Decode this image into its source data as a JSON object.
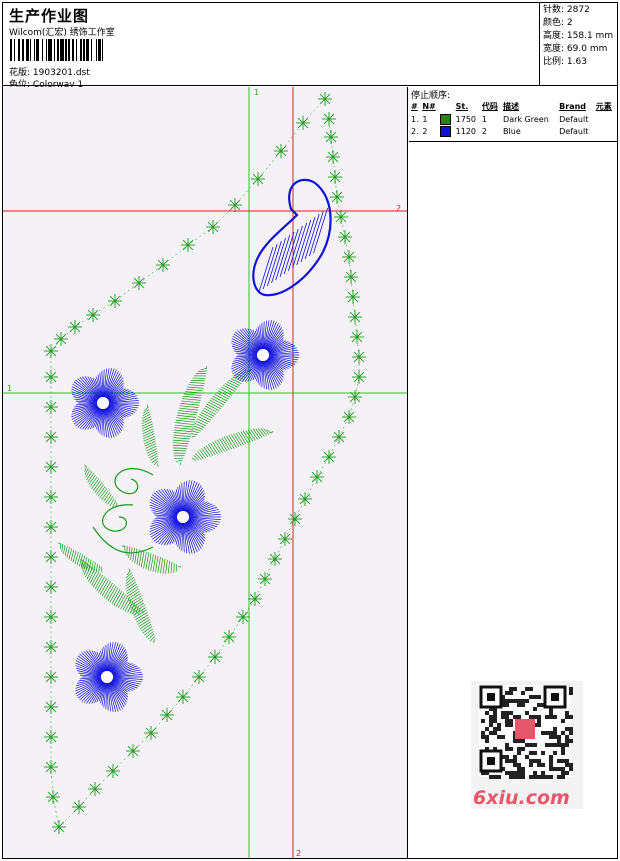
{
  "header": {
    "title": "生产作业图",
    "subtitle": "Wilcom(汇宏) 绣饰工作室",
    "design_label": "花版:",
    "design_value": "1903201.dst",
    "colorway_label": "色位:",
    "colorway_value": "Colorway 1"
  },
  "stats": [
    {
      "label": "针数:",
      "value": "2872"
    },
    {
      "label": "颜色:",
      "value": "2"
    },
    {
      "label": "高度:",
      "value": "158.1 mm"
    },
    {
      "label": "宽度:",
      "value": "69.0 mm"
    },
    {
      "label": "比例:",
      "value": "1.63"
    }
  ],
  "stop_sequence": {
    "title": "停止顺序:",
    "columns": [
      "#",
      "N#",
      "St.",
      "代码",
      "描述",
      "Brand",
      "元素"
    ],
    "rows": [
      {
        "num": "1.",
        "n": "1",
        "color": "#1a8a1a",
        "stitches": "1750",
        "code": "1",
        "desc": "Dark Green",
        "brand": "Default"
      },
      {
        "num": "2.",
        "n": "2",
        "color": "#1010e0",
        "stitches": "1120",
        "code": "2",
        "desc": "Blue",
        "brand": "Default"
      }
    ]
  },
  "guides": {
    "vertical_1": "1",
    "vertical_2": "2",
    "horizontal_1": "1",
    "horizontal_2": "2"
  },
  "colors": {
    "green": "#1a9a1a",
    "blue": "#1010e0",
    "guide_green": "#22cc22",
    "guide_red": "#dd2222",
    "watermark": "#e8566b"
  },
  "watermark": "6xiu.com"
}
